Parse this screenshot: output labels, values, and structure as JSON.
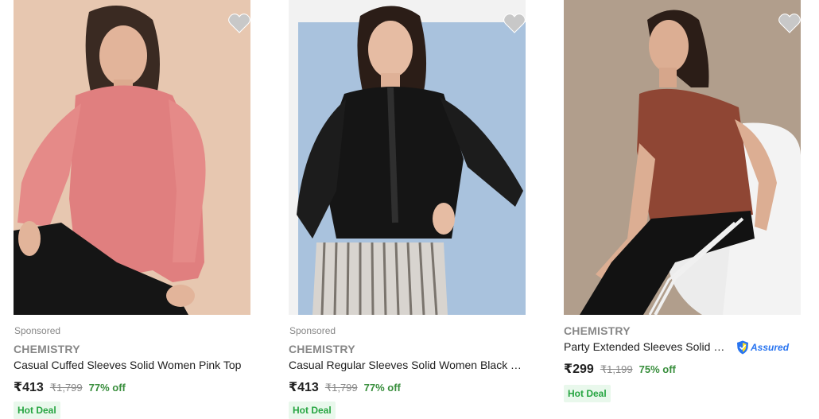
{
  "colors": {
    "price": "#212121",
    "brand": "#878787",
    "discount": "#388e3c",
    "deal_text": "#26a541",
    "deal_bg": "#e9f8ec",
    "assured": "#2874f0",
    "wishlist": "#c8c8c8"
  },
  "products": [
    {
      "sponsored": "Sponsored",
      "brand": "CHEMISTRY",
      "title": "Casual Cuffed Sleeves Solid Women Pink Top",
      "price": "₹413",
      "mrp": "₹1,799",
      "discount": "77% off",
      "deal": "Hot Deal",
      "icon": "heart-icon"
    },
    {
      "sponsored": "Sponsored",
      "brand": "CHEMISTRY",
      "title": "Casual Regular Sleeves Solid Women Black T...",
      "price": "₹413",
      "mrp": "₹1,799",
      "discount": "77% off",
      "deal": "Hot Deal",
      "icon": "heart-icon"
    },
    {
      "brand": "CHEMISTRY",
      "title": "Party Extended Sleeves Solid W...",
      "assured": "Assured",
      "price": "₹299",
      "mrp": "₹1,199",
      "discount": "75% off",
      "deal": "Hot Deal",
      "icon": "heart-icon"
    }
  ]
}
